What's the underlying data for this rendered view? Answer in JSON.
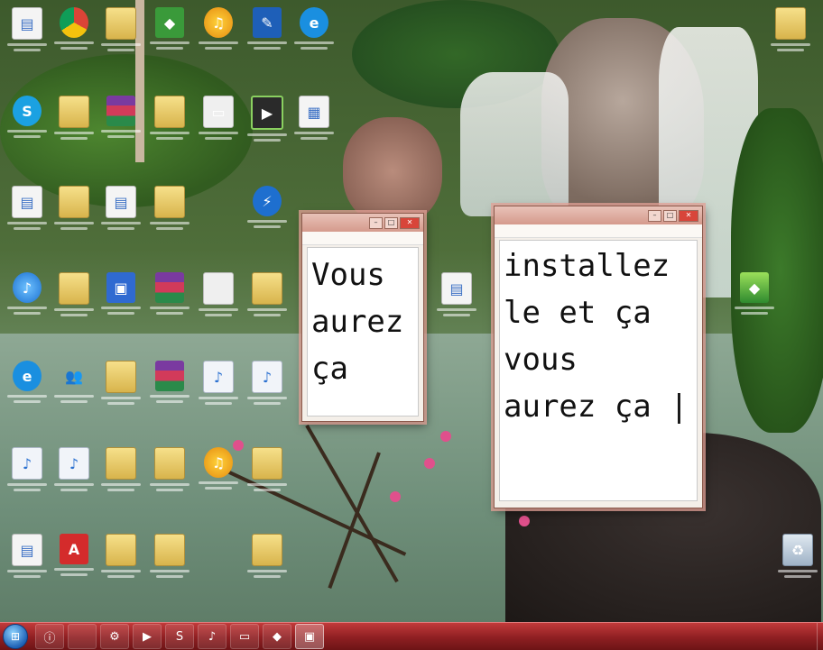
{
  "desktop": {
    "icons": [
      {
        "type": "doc",
        "glyph": "▤"
      },
      {
        "type": "chrome",
        "glyph": ""
      },
      {
        "type": "folder",
        "glyph": ""
      },
      {
        "type": "green",
        "glyph": "◆"
      },
      {
        "type": "audio",
        "glyph": "♫"
      },
      {
        "type": "blue2",
        "glyph": "✎"
      },
      {
        "type": "ie",
        "glyph": "e"
      },
      {
        "type": "skype",
        "glyph": "S"
      },
      {
        "type": "folder",
        "glyph": ""
      },
      {
        "type": "winrar",
        "glyph": ""
      },
      {
        "type": "folder",
        "glyph": ""
      },
      {
        "type": "white",
        "glyph": "▭"
      },
      {
        "type": "media",
        "glyph": "▶"
      },
      {
        "type": "doc",
        "glyph": "▦"
      },
      {
        "type": "doc",
        "glyph": "▤"
      },
      {
        "type": "folder",
        "glyph": ""
      },
      {
        "type": "doc",
        "glyph": "▤"
      },
      {
        "type": "folder",
        "glyph": ""
      },
      {
        "type": "thunder",
        "glyph": "⚡"
      },
      {
        "type": "itunes",
        "glyph": "♪"
      },
      {
        "type": "folder",
        "glyph": ""
      },
      {
        "type": "blue",
        "glyph": "▣"
      },
      {
        "type": "winrar",
        "glyph": ""
      },
      {
        "type": "white",
        "glyph": ""
      },
      {
        "type": "folder",
        "glyph": ""
      },
      {
        "type": "ie",
        "glyph": "e"
      },
      {
        "type": "users",
        "glyph": "👥"
      },
      {
        "type": "folder",
        "glyph": ""
      },
      {
        "type": "winrar",
        "glyph": ""
      },
      {
        "type": "music",
        "glyph": "♪"
      },
      {
        "type": "music",
        "glyph": "♪"
      },
      {
        "type": "music",
        "glyph": "♪"
      },
      {
        "type": "music",
        "glyph": "♪"
      },
      {
        "type": "folder",
        "glyph": ""
      },
      {
        "type": "folder",
        "glyph": ""
      },
      {
        "type": "audio",
        "glyph": "♫"
      },
      {
        "type": "folder",
        "glyph": ""
      },
      {
        "type": "doc",
        "glyph": "▤"
      },
      {
        "type": "pdf",
        "glyph": "A"
      },
      {
        "type": "folder",
        "glyph": ""
      },
      {
        "type": "folder",
        "glyph": ""
      },
      {
        "type": "folder",
        "glyph": ""
      },
      {
        "type": "folder",
        "glyph": ""
      },
      {
        "type": "doc",
        "glyph": "▤"
      },
      {
        "type": "bs",
        "glyph": "◆"
      },
      {
        "type": "bin",
        "glyph": "♻"
      }
    ]
  },
  "notepad_small": {
    "menu": [
      "",
      "",
      "",
      ""
    ],
    "text": "Vous\naurez\nça"
  },
  "notepad_large": {
    "menu": [
      "",
      "",
      "",
      ""
    ],
    "text": "installez\nle et ça\nvous\naurez ça |"
  },
  "window_controls": {
    "minimize": "–",
    "maximize": "□",
    "close": "✕"
  },
  "taskbar": {
    "start_glyph": "⊞",
    "buttons": [
      {
        "glyph": "ⓘ",
        "active": false
      },
      {
        "glyph": "",
        "active": false
      },
      {
        "glyph": "⚙",
        "active": false
      },
      {
        "glyph": "▶",
        "active": false
      },
      {
        "glyph": "S",
        "active": false
      },
      {
        "glyph": "♪",
        "active": false
      },
      {
        "glyph": "▭",
        "active": false
      },
      {
        "glyph": "◆",
        "active": false
      },
      {
        "glyph": "▣",
        "active": true
      }
    ],
    "clock_time": "",
    "clock_date": ""
  }
}
